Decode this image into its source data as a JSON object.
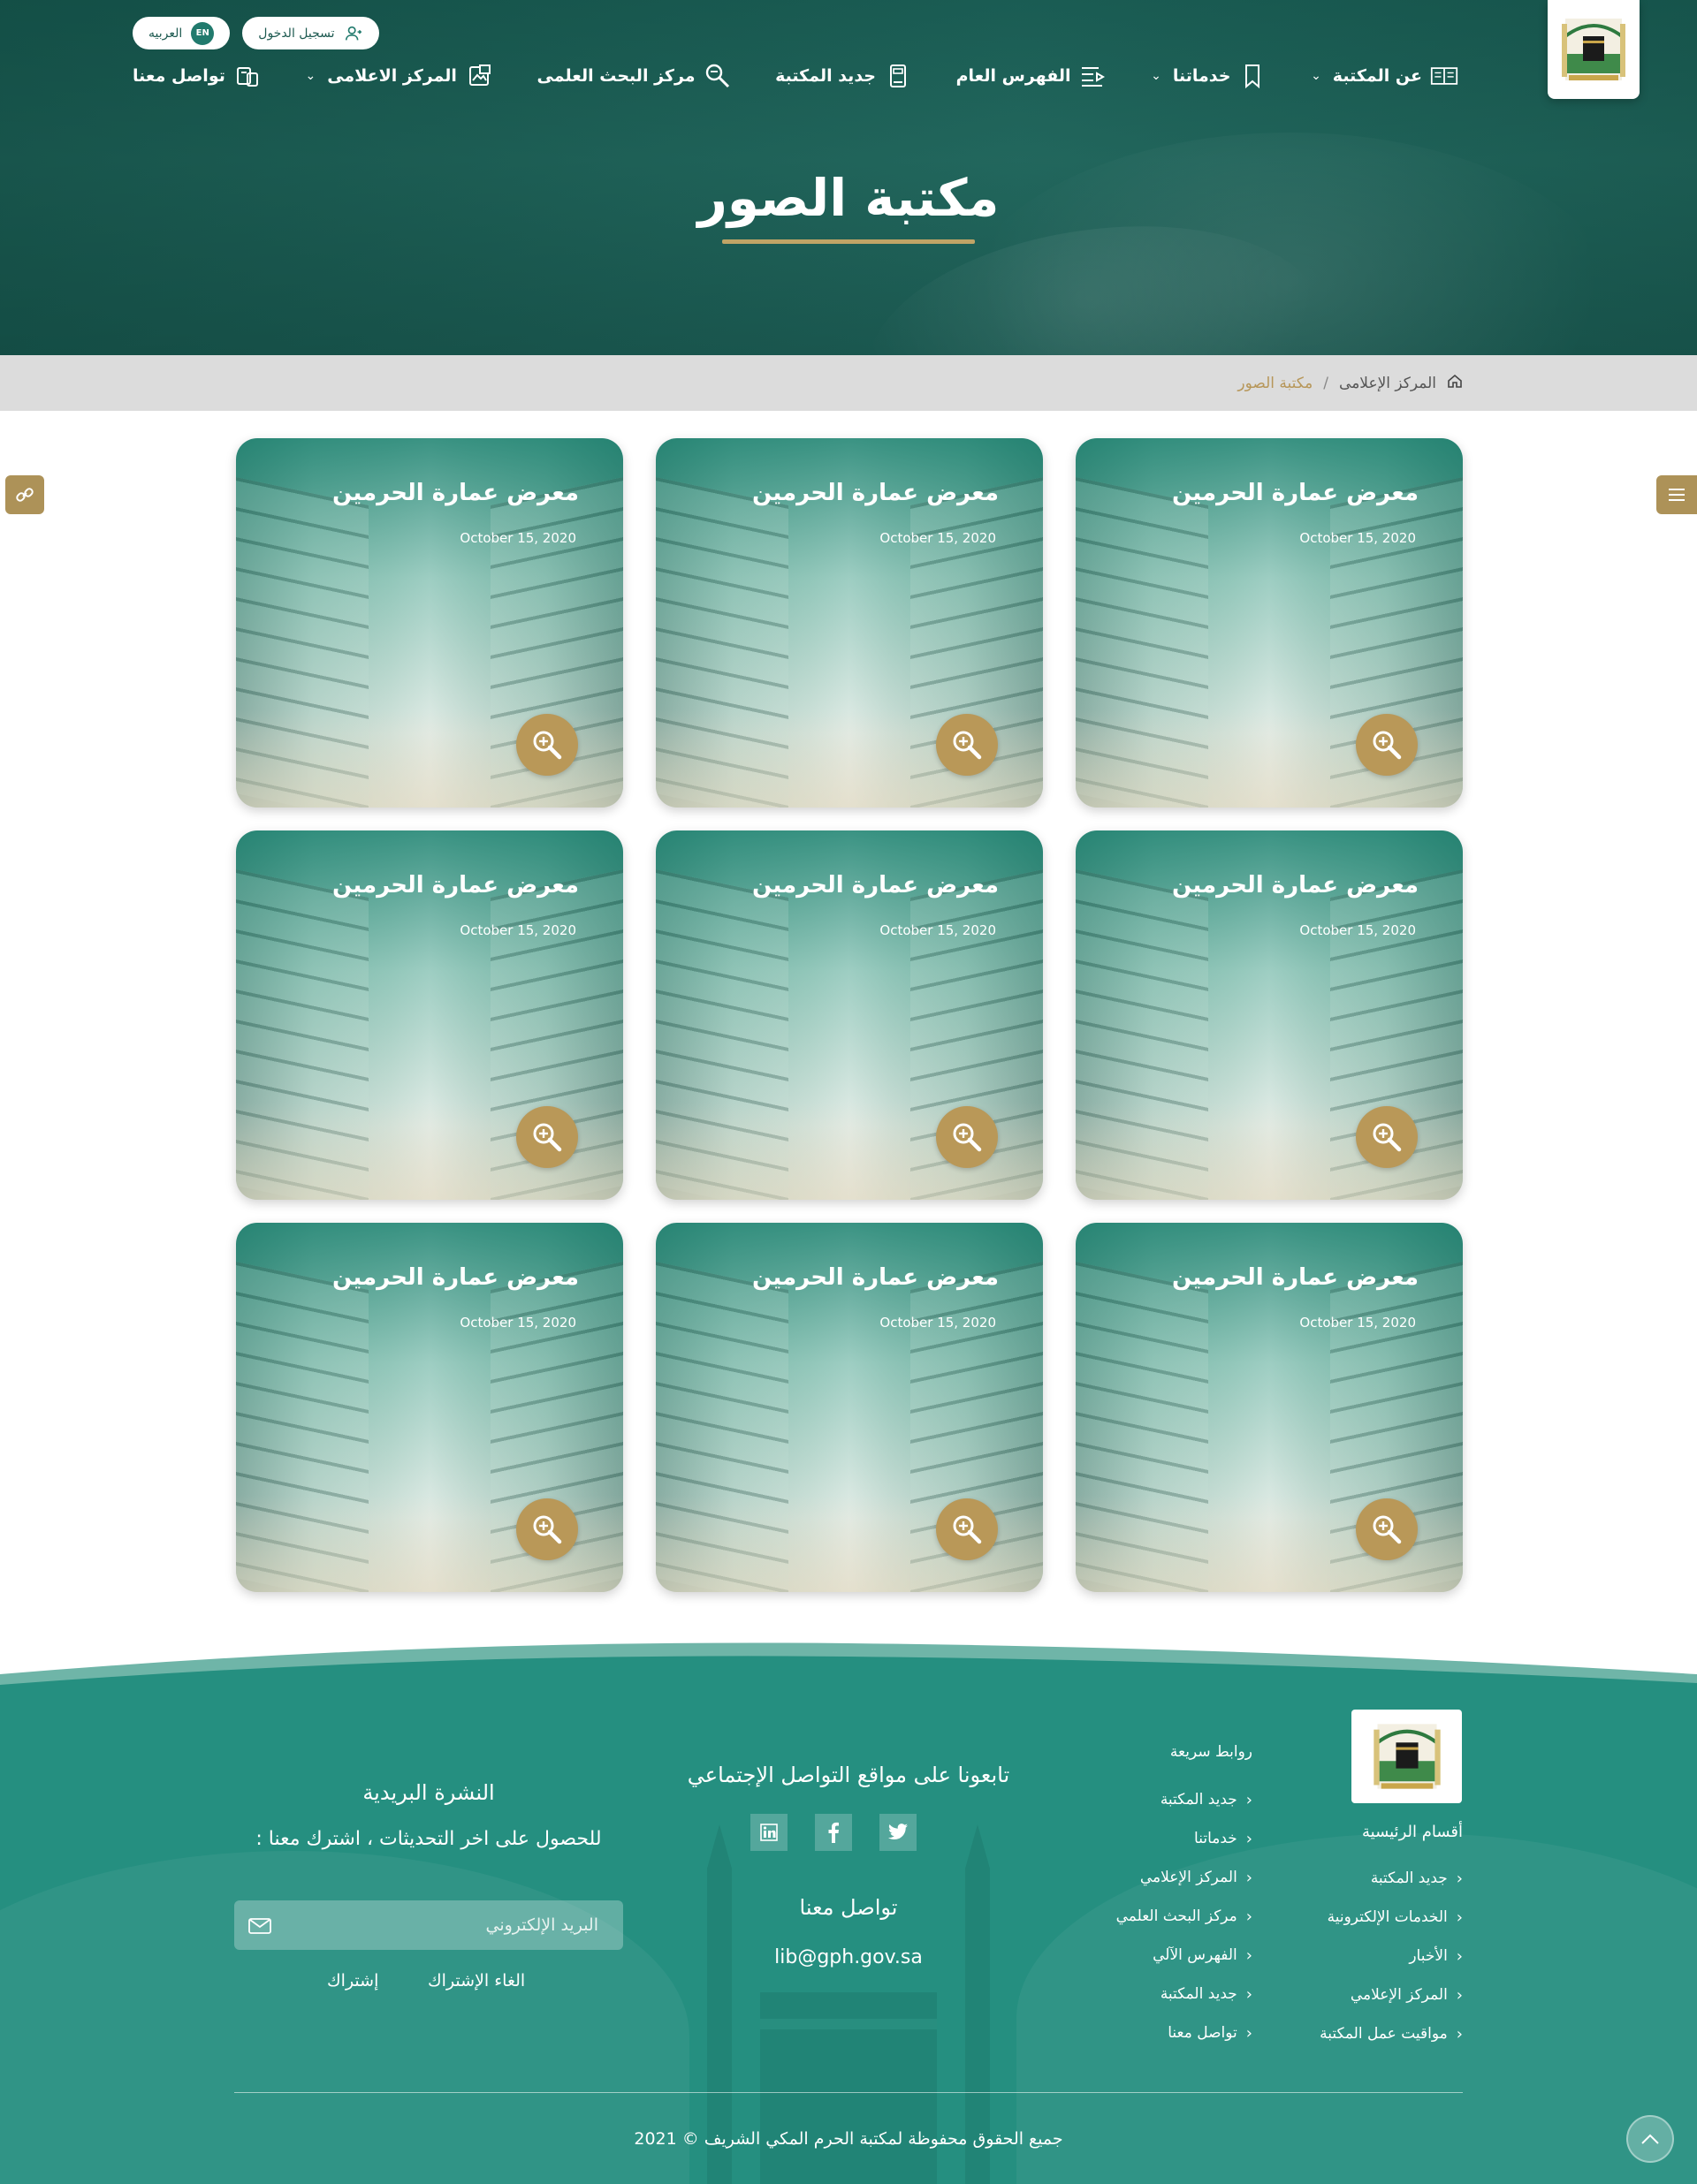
{
  "header": {
    "login_label": "تسجيل الدخول",
    "lang_label": "العربيه",
    "lang_badge": "EN",
    "nav": [
      {
        "label": "عن المكتبة",
        "icon": "book-open-icon",
        "has_dropdown": true
      },
      {
        "label": "خدماتنا",
        "icon": "bookmark-icon",
        "has_dropdown": true
      },
      {
        "label": "الفهرس العام",
        "icon": "list-icon",
        "has_dropdown": false
      },
      {
        "label": "جديد المكتبة",
        "icon": "book-icon",
        "has_dropdown": false
      },
      {
        "label": "مركز البحث العلمى",
        "icon": "search-doc-icon",
        "has_dropdown": false
      },
      {
        "label": "المركز الاعلامى",
        "icon": "media-icon",
        "has_dropdown": true
      },
      {
        "label": "تواصل معنا",
        "icon": "contact-icon",
        "has_dropdown": false
      }
    ],
    "page_title": "مكتبة الصور"
  },
  "breadcrumb": {
    "home_icon": "home-icon",
    "parent": "المركز الإعلامى",
    "separator": "/",
    "current": "مكتبة الصور"
  },
  "gallery": {
    "cards": [
      {
        "title": "معرض عمارة الحرمين",
        "date": "October 15, 2020"
      },
      {
        "title": "معرض عمارة الحرمين",
        "date": "October 15, 2020"
      },
      {
        "title": "معرض عمارة الحرمين",
        "date": "October 15, 2020"
      },
      {
        "title": "معرض عمارة الحرمين",
        "date": "October 15, 2020"
      },
      {
        "title": "معرض عمارة الحرمين",
        "date": "October 15, 2020"
      },
      {
        "title": "معرض عمارة الحرمين",
        "date": "October 15, 2020"
      },
      {
        "title": "معرض عمارة الحرمين",
        "date": "October 15, 2020"
      },
      {
        "title": "معرض عمارة الحرمين",
        "date": "October 15, 2020"
      },
      {
        "title": "معرض عمارة الحرمين",
        "date": "October 15, 2020"
      }
    ]
  },
  "footer": {
    "main_sections_title": "أقسام الرئيسية",
    "main_sections": [
      "جديد المكتبة",
      "الخدمات الإلكترونية",
      "الأخبار",
      "المركز الإعلامي",
      "مواقيت عمل المكتبة"
    ],
    "quick_links_title": "روابط سريعة",
    "quick_links": [
      "جديد المكتبة",
      "خدماتنا",
      "المركز الإعلامي",
      "مركز البحث العلمي",
      "الفهرس الآلي",
      "جديد المكتبة",
      "تواصل معنا"
    ],
    "social_title": "تابعونا على مواقع التواصل الإجتماعي",
    "social": [
      "twitter-icon",
      "facebook-icon",
      "linkedin-icon"
    ],
    "contact_title": "تواصل معنا",
    "contact_email": "lib@gph.gov.sa",
    "newsletter_title": "النشرة البريدية",
    "newsletter_subtitle": "للحصول على اخر التحديثات ، اشترك معنا :",
    "email_placeholder": "البريد الإلكتروني",
    "subscribe_label": "إشتراك",
    "unsubscribe_label": "الغاء الإشتراك",
    "copyright": "جميع الحقوق محفوظة لمكتبة الحرم المكي الشريف © 2021"
  },
  "colors": {
    "primary_green": "#258f80",
    "gold": "#b99858",
    "hero_dark": "#1b5e55"
  }
}
